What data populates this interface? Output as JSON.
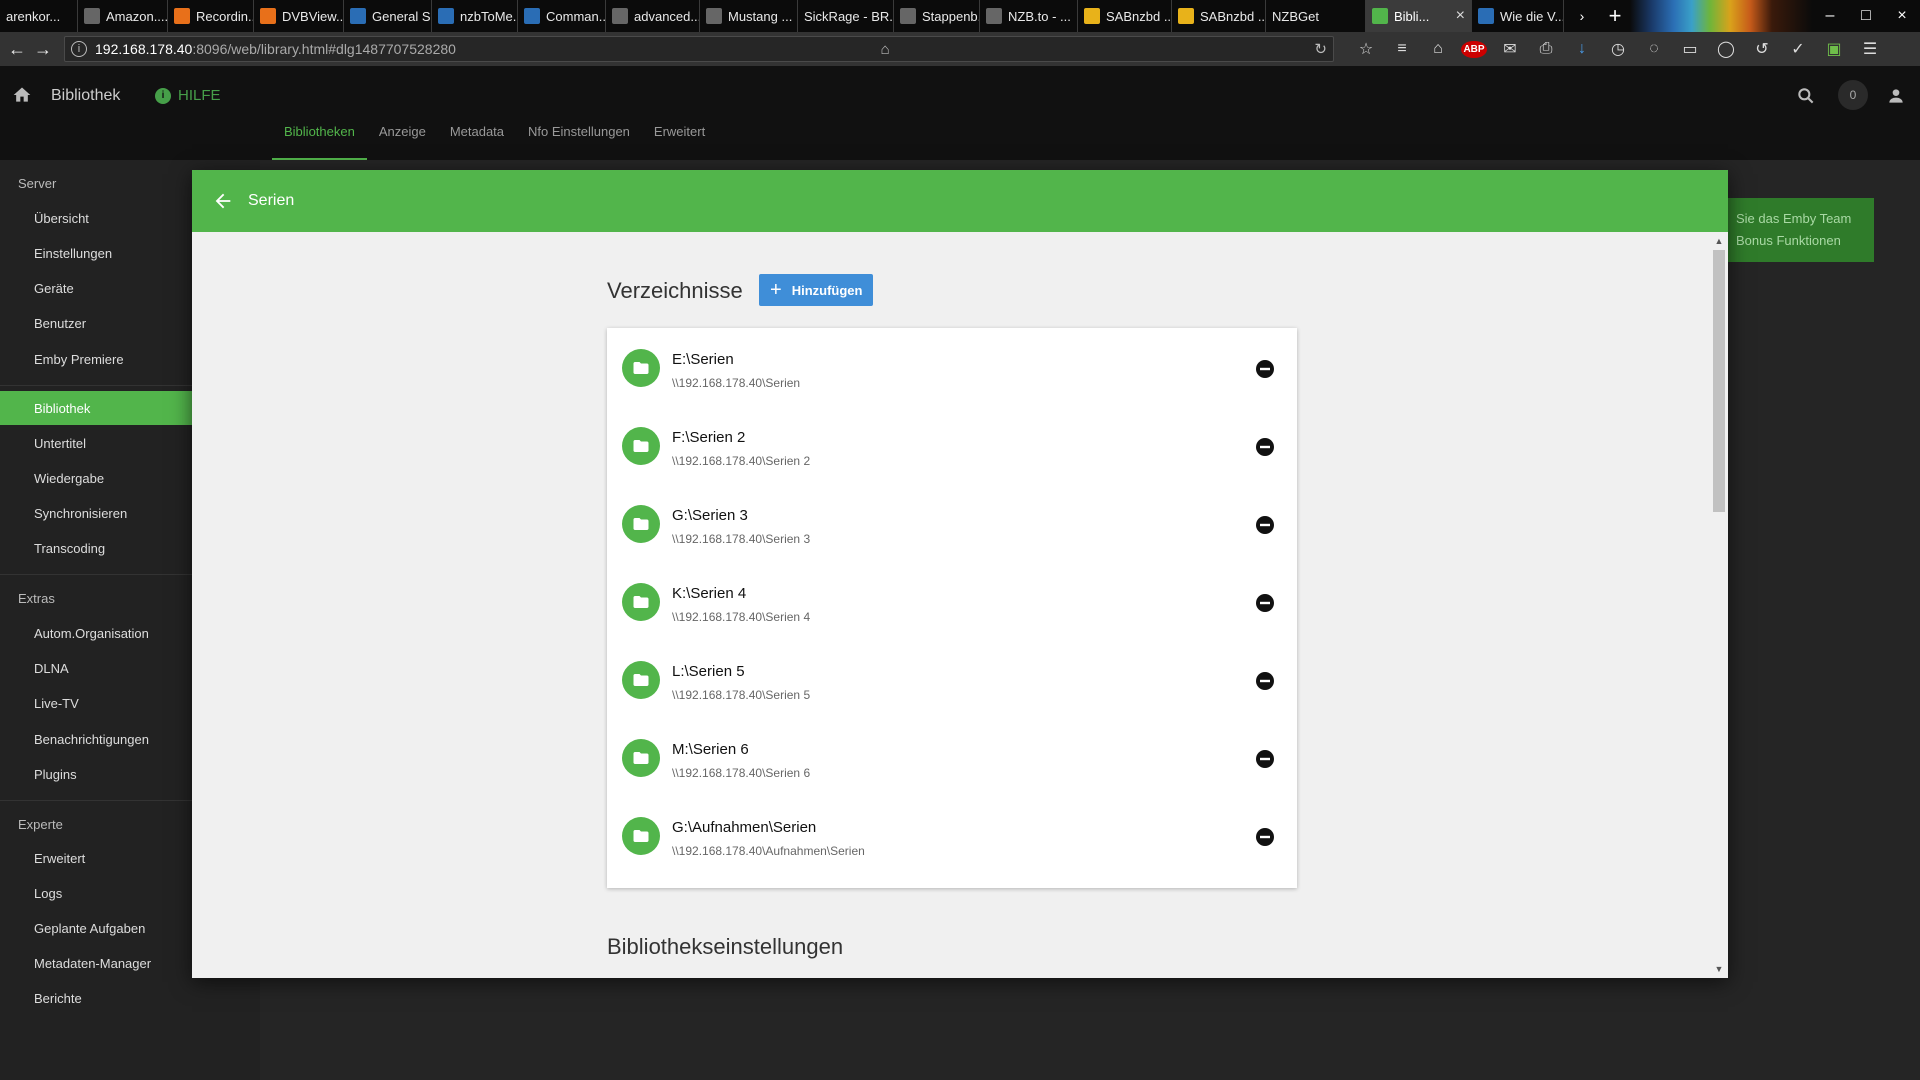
{
  "browser": {
    "tabs": [
      {
        "title": "arenkor...",
        "icon": "bookmark-icon"
      },
      {
        "title": "Amazon....",
        "icon": "amazon-icon"
      },
      {
        "title": "Recordin...",
        "icon": "rss-icon"
      },
      {
        "title": "DVBView...",
        "icon": "rss-icon"
      },
      {
        "title": "General S...",
        "icon": "forum-icon"
      },
      {
        "title": "nzbToMe...",
        "icon": "forum-icon"
      },
      {
        "title": "Comman...",
        "icon": "kodi-icon"
      },
      {
        "title": "advanced...",
        "icon": "page-icon"
      },
      {
        "title": "Mustang ...",
        "icon": "checker-icon"
      },
      {
        "title": "SickRage - BR...",
        "icon": "blank-icon"
      },
      {
        "title": "Stappenb...",
        "icon": "page-icon"
      },
      {
        "title": "NZB.to - ...",
        "icon": "nzbto-icon"
      },
      {
        "title": "SABnzbd ...",
        "icon": "sabnzbd-icon"
      },
      {
        "title": "SABnzbd ...",
        "icon": "sabnzbd-icon"
      },
      {
        "title": "NZBGet",
        "icon": "blank-icon"
      },
      {
        "title": "Bibli...",
        "icon": "emby-icon",
        "active": true
      },
      {
        "title": "Wie die V...",
        "icon": "forum-icon"
      }
    ],
    "url_host": "192.168.178.40",
    "url_path": ":8096/web/library.html#dlg1487707528280"
  },
  "header": {
    "title": "Bibliothek",
    "help_label": "HILFE",
    "notification_count": "0",
    "tabs": [
      {
        "label": "Bibliotheken",
        "active": true
      },
      {
        "label": "Anzeige"
      },
      {
        "label": "Metadata"
      },
      {
        "label": "Nfo Einstellungen"
      },
      {
        "label": "Erweitert"
      }
    ]
  },
  "sidebar": {
    "server_heading": "Server",
    "server_items": [
      "Übersicht",
      "Einstellungen",
      "Geräte",
      "Benutzer",
      "Emby Premiere"
    ],
    "server_items2": [
      "Bibliothek",
      "Untertitel",
      "Wiedergabe",
      "Synchronisieren",
      "Transcoding"
    ],
    "active_item": "Bibliothek",
    "extras_heading": "Extras",
    "extras_items": [
      "Autom.Organisation",
      "DLNA",
      "Live-TV",
      "Benachrichtigungen",
      "Plugins"
    ],
    "experte_heading": "Experte",
    "experte_items": [
      "Erweitert",
      "Logs",
      "Geplante Aufgaben",
      "Metadaten-Manager",
      "Berichte"
    ]
  },
  "promo": {
    "line1": "Sie das Emby Team",
    "line2": "Bonus Funktionen"
  },
  "dialog": {
    "title": "Serien",
    "folders_heading": "Verzeichnisse",
    "add_label": "Hinzufügen",
    "settings_heading": "Bibliothekseinstellungen",
    "folders": [
      {
        "path": "E:\\Serien",
        "network": "\\\\192.168.178.40\\Serien"
      },
      {
        "path": "F:\\Serien 2",
        "network": "\\\\192.168.178.40\\Serien 2"
      },
      {
        "path": "G:\\Serien 3",
        "network": "\\\\192.168.178.40\\Serien 3"
      },
      {
        "path": "K:\\Serien 4",
        "network": "\\\\192.168.178.40\\Serien 4"
      },
      {
        "path": "L:\\Serien 5",
        "network": "\\\\192.168.178.40\\Serien 5"
      },
      {
        "path": "M:\\Serien 6",
        "network": "\\\\192.168.178.40\\Serien 6"
      },
      {
        "path": "G:\\Aufnahmen\\Serien",
        "network": "\\\\192.168.178.40\\Aufnahmen\\Serien"
      }
    ]
  },
  "colors": {
    "accent": "#52b54b",
    "button_blue": "#3f8ed8"
  }
}
